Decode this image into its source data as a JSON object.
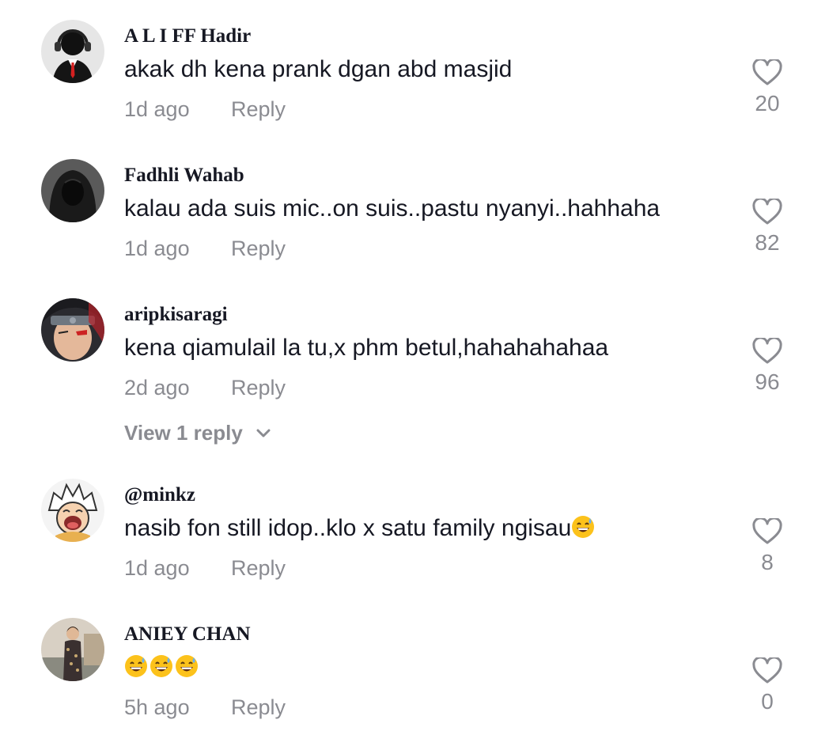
{
  "comments": [
    {
      "username": "A L I FF Hadir",
      "text": "akak dh kena prank dgan abd masjid",
      "time": "1d ago",
      "reply_label": "Reply",
      "likes": "20",
      "avatar_icon": "headset-avatar-icon"
    },
    {
      "username": "Fadhli Wahab",
      "text": "kalau ada suis mic..on suis..pastu nyanyi..hahhaha",
      "time": "1d ago",
      "reply_label": "Reply",
      "likes": "82",
      "avatar_icon": "hooded-person-avatar-icon"
    },
    {
      "username": "aripkisaragi",
      "text": "kena qiamulail la tu,x phm betul,hahahahahaa",
      "time": "2d ago",
      "reply_label": "Reply",
      "likes": "96",
      "avatar_icon": "anime-ninja-avatar-icon"
    },
    {
      "username": "@minkz",
      "text": "nasib fon still idop..klo x satu family ngisau",
      "emojis": [
        "grinning-sweat-emoji"
      ],
      "time": "1d ago",
      "reply_label": "Reply",
      "likes": "8",
      "avatar_icon": "anime-cartoon-avatar-icon"
    },
    {
      "username": "ANIEY CHAN",
      "text": "",
      "emojis": [
        "grinning-sweat-emoji",
        "grinning-sweat-emoji",
        "grinning-sweat-emoji"
      ],
      "time": "5h ago",
      "reply_label": "Reply",
      "likes": "0",
      "avatar_icon": "woman-photo-avatar-icon"
    }
  ],
  "view_replies_label": "View 1 reply",
  "colors": {
    "text": "#161823",
    "muted": "#8a8b91",
    "background": "#ffffff"
  }
}
